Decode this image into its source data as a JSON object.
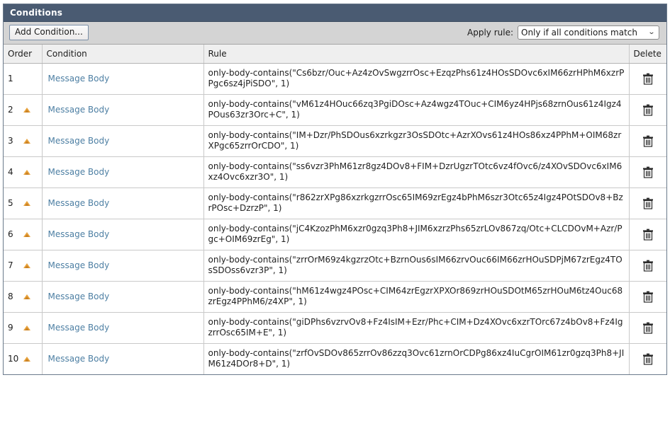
{
  "panel": {
    "title": "Conditions"
  },
  "toolbar": {
    "add_condition_label": "Add Condition...",
    "apply_rule_label": "Apply rule:",
    "apply_rule_value": "Only if all conditions match",
    "apply_rule_options": [
      "Only if all conditions match"
    ],
    "chevron": "⌄"
  },
  "table": {
    "columns": [
      "Order",
      "Condition",
      "Rule",
      "Delete"
    ],
    "rows": [
      {
        "order": "1",
        "has_move_up": false,
        "condition": "Message Body",
        "rule": "only-body-contains(\"Cs6bzr/Ouc+Az4zOvSwgzrrOsc+EzqzPhs61z4HOsSDOvc6xIM66zrHPhM6xzrPPgc6sz4jPiSDO\", 1)"
      },
      {
        "order": "2",
        "has_move_up": true,
        "condition": "Message Body",
        "rule": "only-body-contains(\"vM61z4HOuc66zq3PgiDOsc+Az4wgz4TOuc+CIM6yz4HPjs68zrnOus61z4Igz4POus63zr3Orc+C\", 1)"
      },
      {
        "order": "3",
        "has_move_up": true,
        "condition": "Message Body",
        "rule": "only-body-contains(\"IM+Dzr/PhSDOus6xzrkgzr3OsSDOtc+AzrXOvs61z4HOs86xz4PPhM+OIM68zrXPgc65zrrOrCDO\", 1)"
      },
      {
        "order": "4",
        "has_move_up": true,
        "condition": "Message Body",
        "rule": "only-body-contains(\"ss6vzr3PhM61zr8gz4DOv8+FIM+DzrUgzrTOtc6vz4fOvc6/z4XOvSDOvc6xIM6xz4Ovc6xzr3O\", 1)"
      },
      {
        "order": "5",
        "has_move_up": true,
        "condition": "Message Body",
        "rule": "only-body-contains(\"r862zrXPg86xzrkgzrrOsc65IM69zrEgz4bPhM6szr3Otc65z4Igz4POtSDOv8+BzrPOsc+DzrzP\", 1)"
      },
      {
        "order": "6",
        "has_move_up": true,
        "condition": "Message Body",
        "rule": "only-body-contains(\"jC4KzozPhM6xzr0gzq3Ph8+JIM6xzrzPhs65zrLOv867zq/Otc+CLCDOvM+Azr/Pgc+OIM69zrEg\", 1)"
      },
      {
        "order": "7",
        "has_move_up": true,
        "condition": "Message Body",
        "rule": "only-body-contains(\"zrrOrM69z4kgzrzOtc+BzrnOus6sIM66zrvOuc66IM66zrHOuSDPjM67zrEgz4TOsSDOss6vzr3P\", 1)"
      },
      {
        "order": "8",
        "has_move_up": true,
        "condition": "Message Body",
        "rule": "only-body-contains(\"hM61z4wgz4POsc+CIM64zrEgzrXPXOr869zrHOuSDOtM65zrHOuM6tz4Ouc68zrEgz4PPhM6/z4XP\", 1)"
      },
      {
        "order": "9",
        "has_move_up": true,
        "condition": "Message Body",
        "rule": "only-body-contains(\"giDPhs6vzrvOv8+Fz4IsIM+Ezr/Phc+CIM+Dz4XOvc6xzrTOrc67z4bOv8+Fz4IgzrrOsc65IM+E\", 1)"
      },
      {
        "order": "10",
        "has_move_up": true,
        "condition": "Message Body",
        "rule": "only-body-contains(\"zrfOvSDOv865zrrOv86zzq3Ovc61zrnOrCDPg86xz4IuCgrOIM61zr0gzq3Ph8+JIM61z4DOr8+D\", 1)"
      }
    ],
    "delete_icon": "trash-icon"
  }
}
